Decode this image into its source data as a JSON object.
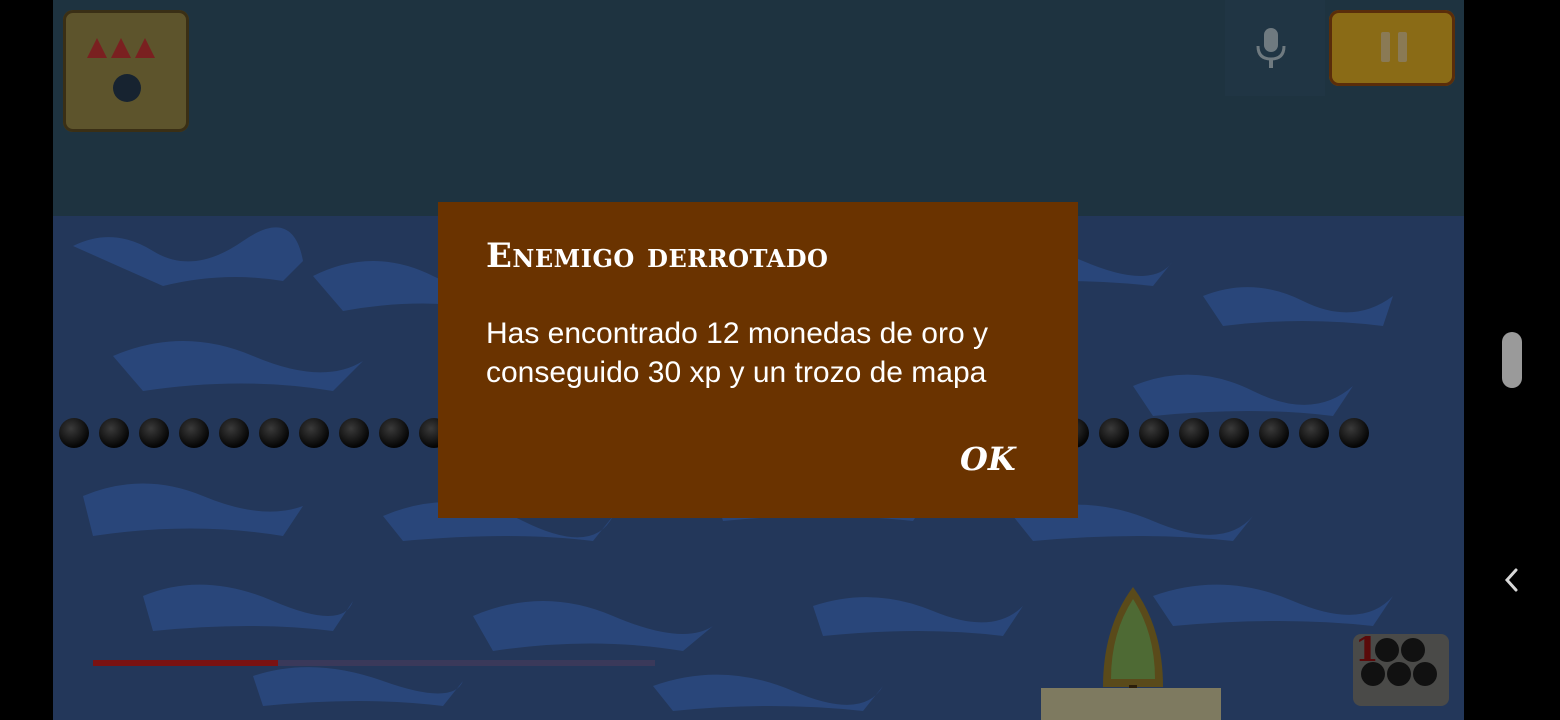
{
  "dialog": {
    "title": "Enemigo derrotado",
    "message": "Has encontrado 12 monedas de oro y conseguido 30 xp y un trozo de mapa",
    "ok_label": "OK"
  },
  "hud": {
    "health_fraction": 0.33,
    "ammo_counter": "1"
  },
  "icons": {
    "ammo": "ammo-selector-icon",
    "mic": "microphone-icon",
    "pause": "pause-icon",
    "back": "back-chevron-icon"
  },
  "colors": {
    "dialog_background": "#6a3300",
    "sky": "#1e3340",
    "sea": "#23375a",
    "pause_button": "#8a6b16",
    "health_bar": "#7a1212"
  }
}
